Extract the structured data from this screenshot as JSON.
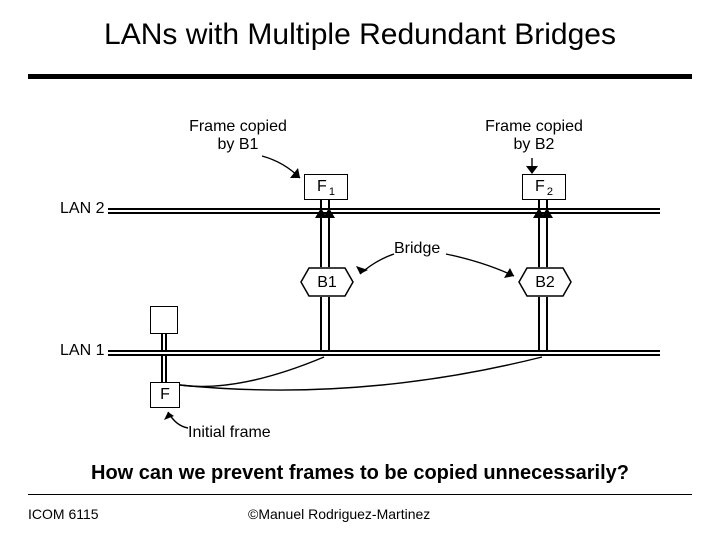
{
  "title": "LANs with Multiple Redundant Bridges",
  "question": "How can we prevent frames to be copied unnecessarily?",
  "footer": {
    "course": "ICOM 6115",
    "copyright": "©Manuel Rodriguez-Martinez"
  },
  "diagram": {
    "lan2": "LAN 2",
    "lan1": "LAN 1",
    "bridge_label": "Bridge",
    "copied_b1_l1": "Frame copied",
    "copied_b1_l2": "by B1",
    "copied_b2_l1": "Frame copied",
    "copied_b2_l2": "by B2",
    "f1_f": "F",
    "f1_sub": "1",
    "f2_f": "F",
    "f2_sub": "2",
    "b1": "B1",
    "b2": "B2",
    "f": "F",
    "initial": "Initial frame"
  }
}
